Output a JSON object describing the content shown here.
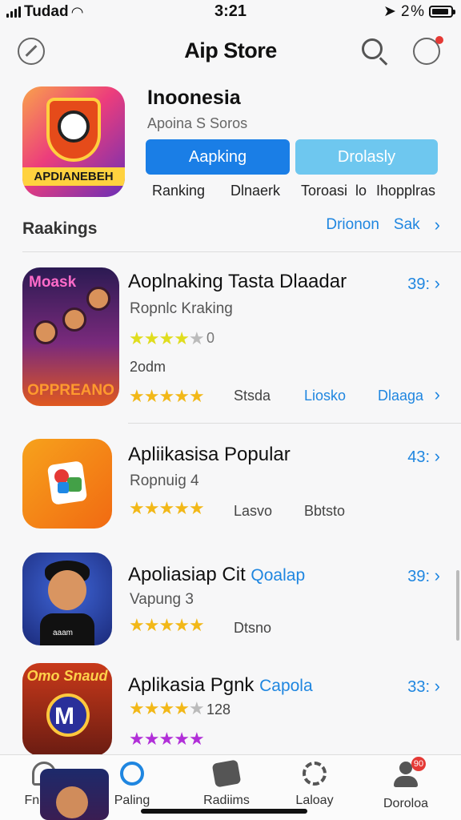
{
  "status": {
    "carrier": "Tudad",
    "time": "3:21",
    "battery": "2 %",
    "battery_level": 0.9
  },
  "header": {
    "title": "Aip Store"
  },
  "featured": {
    "title": "Inoonesia",
    "subtitle": "Apoina S Soros",
    "icon_text": "APDIANEBEH",
    "primary_button": "Aapking",
    "secondary_button": "Drolasly",
    "labels": [
      "Ranking",
      "Dlnaerk",
      "Toroasi",
      "lo",
      "Ihopplras"
    ]
  },
  "section": {
    "title": "Raakings",
    "links": [
      "Drionon",
      "Sak"
    ]
  },
  "apps": [
    {
      "icon_top": "Moask",
      "icon_bottom": "OPPREANO",
      "name": "Aoplnaking Tasta Dlaadar",
      "subtitle": "Ropnlc Kraking",
      "rating_text": "0",
      "extra": "2odm",
      "count": "39:",
      "stars_bottom_links": [
        "Stsda",
        "Liosko",
        "Dlaaga"
      ],
      "rating": 3.5,
      "rating_bottom": 4.5
    },
    {
      "name": "Apliikasisa Popular",
      "subtitle": "Ropnuig 4",
      "count": "43:",
      "labels": [
        "Lasvo",
        "Bbtsto"
      ],
      "rating": 5
    },
    {
      "name": "Apoliasiap Cit",
      "name_accent": "Qoalap",
      "subtitle": "Vapung 3",
      "count": "39:",
      "label": "Dtsno",
      "icon_text": "aaam",
      "rating": 5
    },
    {
      "icon_text": "Omo Snaud",
      "name": "Aplikasia Pgnk",
      "name_accent": "Capola",
      "count": "33:",
      "rating_text": "128",
      "rating": 3.5,
      "rating_bottom": 5
    }
  ],
  "tabs": [
    {
      "label": "Fngloe",
      "icon": "bell-icon"
    },
    {
      "label": "Paling",
      "icon": "swirl-icon"
    },
    {
      "label": "Radiims",
      "icon": "rocket-icon"
    },
    {
      "label": "Laloay",
      "icon": "gear-icon"
    },
    {
      "label": "Doroloa",
      "icon": "user-icon",
      "badge": "90"
    }
  ],
  "colors": {
    "accent": "#1f86e0",
    "primary_button": "#1a7ee6",
    "secondary_button": "#6ec7ef",
    "star": "#f2b818",
    "star_purple": "#b12fd8",
    "badge": "#e53935"
  }
}
